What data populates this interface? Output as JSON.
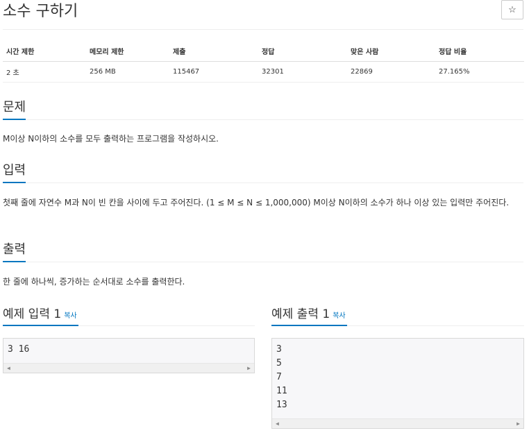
{
  "problem": {
    "title": "소수 구하기",
    "star_icon": "☆"
  },
  "info_table": {
    "headers": [
      "시간 제한",
      "메모리 제한",
      "제출",
      "정답",
      "맞은 사람",
      "정답 비율"
    ],
    "row": [
      "2 초",
      "256 MB",
      "115467",
      "32301",
      "22869",
      "27.165%"
    ]
  },
  "sections": {
    "problem_heading": "문제",
    "problem_text": "M이상 N이하의 소수를 모두 출력하는 프로그램을 작성하시오.",
    "input_heading": "입력",
    "input_text": "첫째 줄에 자연수 M과 N이 빈 칸을 사이에 두고 주어진다. (1 ≤ M ≤ N ≤ 1,000,000) M이상 N이하의 소수가 하나 이상 있는 입력만 주어진다.",
    "output_heading": "출력",
    "output_text": "한 줄에 하나씩, 증가하는 순서대로 소수를 출력한다."
  },
  "sample_input": {
    "heading": "예제 입력 1",
    "copy_label": "복사",
    "content": "3 16"
  },
  "sample_output": {
    "heading": "예제 출력 1",
    "copy_label": "복사",
    "content": "3\n5\n7\n11\n13"
  },
  "colors": {
    "accent": "#0076c0",
    "text": "#333333",
    "sample_bg": "#f7f7f9"
  }
}
